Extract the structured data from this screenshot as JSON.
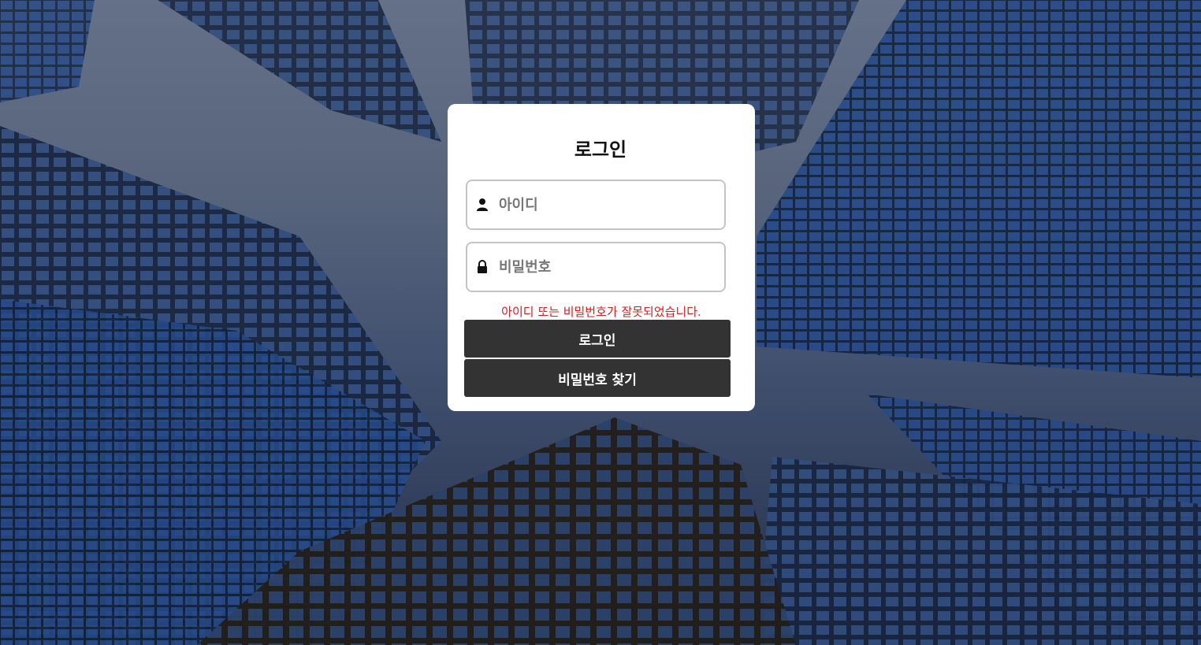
{
  "page": {
    "title": "로그인"
  },
  "form": {
    "username_placeholder": "아이디",
    "username_value": "",
    "password_placeholder": "비밀번호",
    "password_value": "",
    "error_message": "아이디 또는 비밀번호가 잘못되었습니다.",
    "login_button": "로그인",
    "find_password_button": "비밀번호 찾기"
  },
  "icons": {
    "username": "user-icon",
    "password": "lock-icon"
  },
  "colors": {
    "error": "#d02020",
    "button": "#333333",
    "card": "#ffffff"
  }
}
